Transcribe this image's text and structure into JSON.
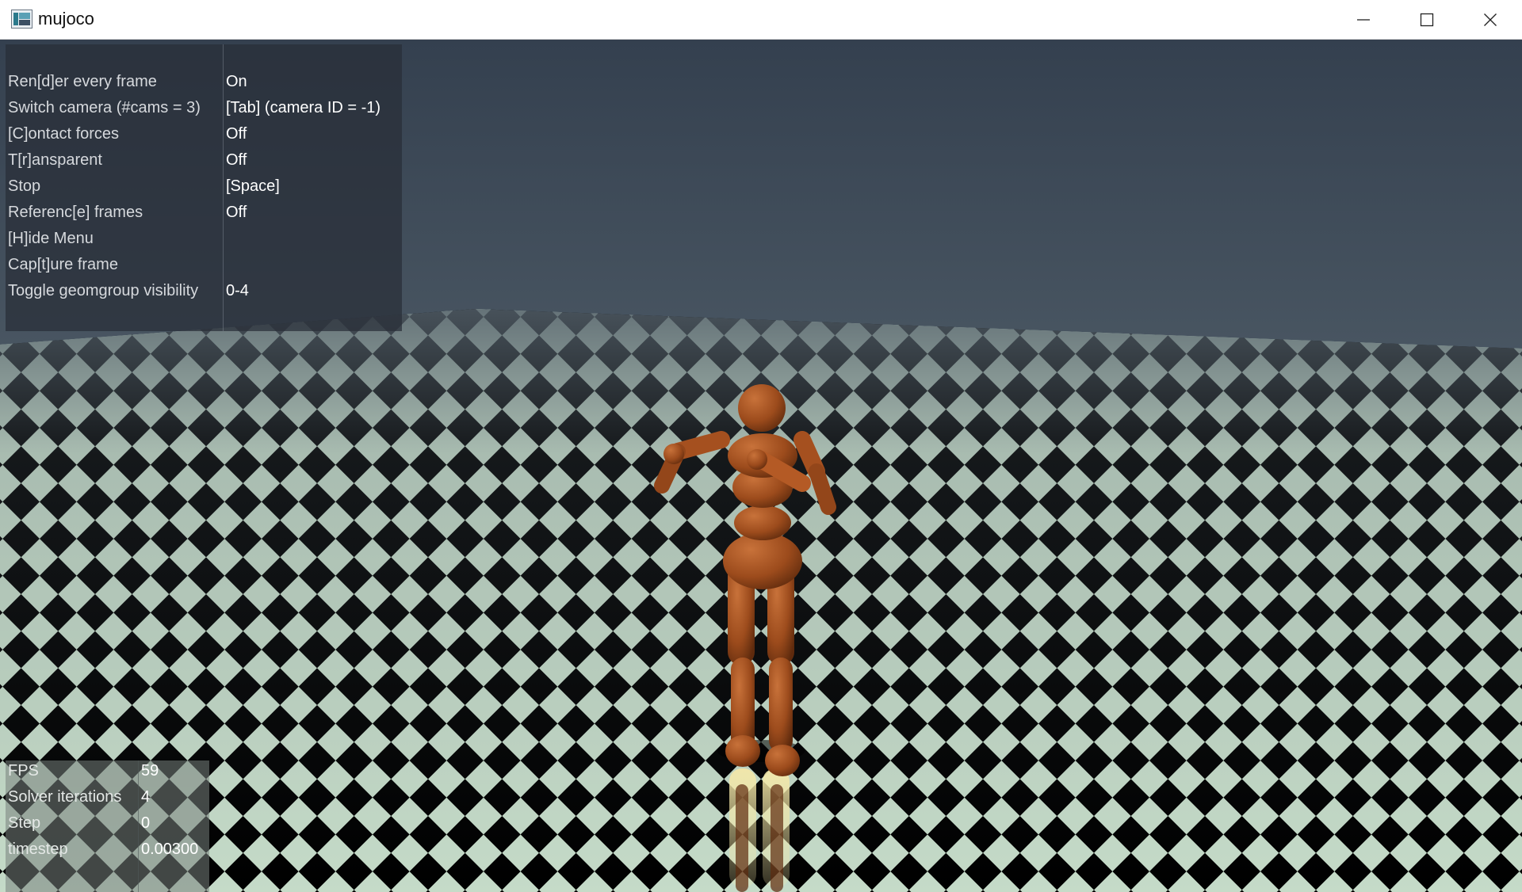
{
  "window": {
    "title": "mujoco"
  },
  "menu": {
    "items": [
      {
        "label": "Ren[d]er every frame",
        "value": "On"
      },
      {
        "label": "Switch camera (#cams = 3)",
        "value": "[Tab] (camera ID = -1)"
      },
      {
        "label": "[C]ontact forces",
        "value": "Off"
      },
      {
        "label": "T[r]ansparent",
        "value": "Off"
      },
      {
        "label": "Stop",
        "value": "[Space]"
      },
      {
        "label": "Referenc[e] frames",
        "value": "Off"
      },
      {
        "label": "[H]ide Menu",
        "value": ""
      },
      {
        "label": "Cap[t]ure frame",
        "value": ""
      },
      {
        "label": "Toggle geomgroup visibility",
        "value": "0-4"
      }
    ]
  },
  "info": {
    "items": [
      {
        "label": "FPS",
        "value": "59"
      },
      {
        "label": "Solver iterations",
        "value": "4"
      },
      {
        "label": "Step",
        "value": "0"
      },
      {
        "label": "timestep",
        "value": "0.00300"
      }
    ]
  },
  "colors": {
    "sky_top": "#34404f",
    "sky_bottom": "#46535f",
    "floor_light": "#c5dbc8",
    "floor_dark": "#000000",
    "humanoid": "#a5501f"
  },
  "icons": {
    "app": "mujoco-app-icon",
    "minimize": "minimize-icon",
    "maximize": "maximize-icon",
    "close": "close-icon"
  }
}
